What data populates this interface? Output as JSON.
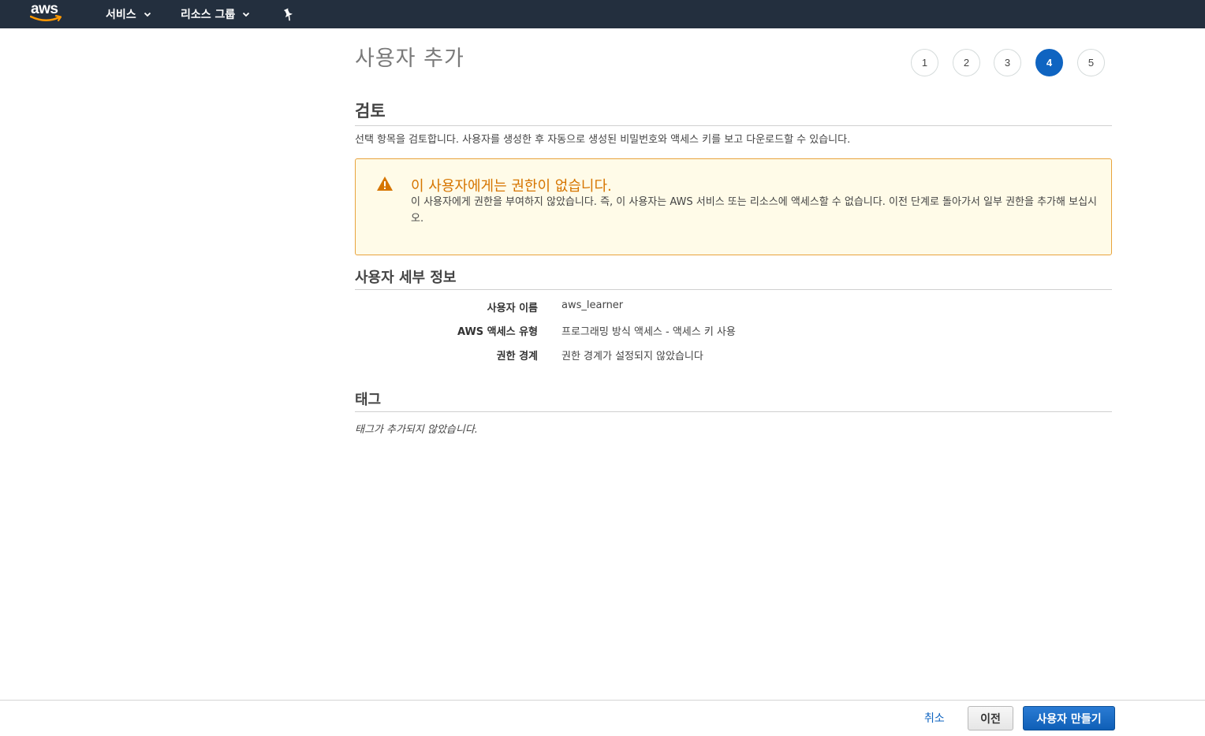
{
  "topnav": {
    "logo_text": "aws",
    "services_label": "서비스",
    "resource_groups_label": "리소스 그룹"
  },
  "page_title": "사용자 추가",
  "steps": {
    "items": [
      "1",
      "2",
      "3",
      "4",
      "5"
    ],
    "current": "4"
  },
  "review": {
    "heading": "검토",
    "description": "선택 항목을 검토합니다. 사용자를 생성한 후 자동으로 생성된 비밀번호와 액세스 키를 보고 다운로드할 수 있습니다."
  },
  "alert": {
    "title": "이 사용자에게는 권한이 없습니다.",
    "body": "이 사용자에게 권한을 부여하지 않았습니다. 즉, 이 사용자는 AWS 서비스 또는 리소스에 액세스할 수 없습니다. 이전 단계로 돌아가서 일부 권한을 추가해 보십시오."
  },
  "user_details": {
    "heading": "사용자 세부 정보",
    "rows": [
      {
        "label": "사용자 이름",
        "value": "aws_learner"
      },
      {
        "label": "AWS 액세스 유형",
        "value": "프로그래밍 방식 액세스 - 액세스 키 사용"
      },
      {
        "label": "권한 경계",
        "value": "권한 경계가 설정되지 않았습니다"
      }
    ]
  },
  "tags": {
    "heading": "태그",
    "empty_text": "태그가 추가되지 않았습니다."
  },
  "footer": {
    "cancel_label": "취소",
    "previous_label": "이전",
    "create_label": "사용자 만들기"
  },
  "colors": {
    "nav_bg": "#232f3e",
    "accent_blue": "#0f64c1",
    "warning_orange": "#d67500",
    "warning_bg": "#fffbe8",
    "aws_smile": "#ff9900"
  }
}
